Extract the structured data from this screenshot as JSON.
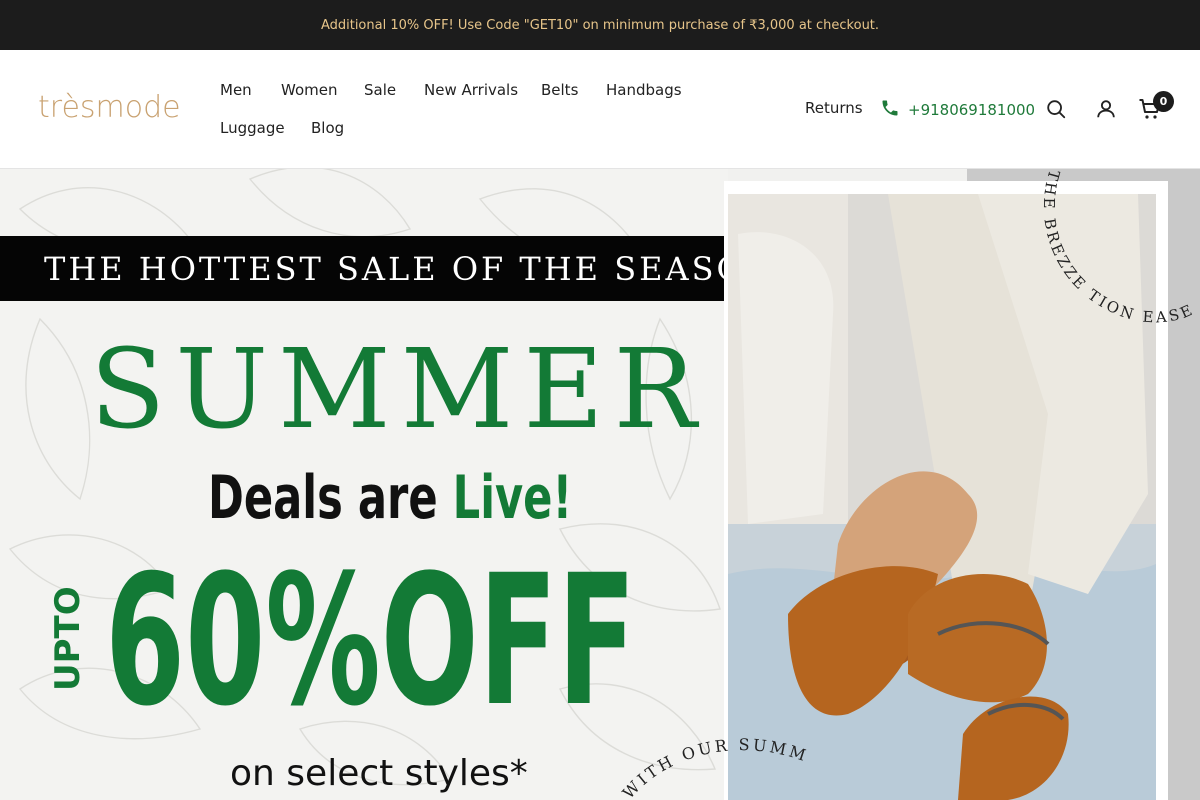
{
  "announcement": {
    "text": "Additional 10% OFF! Use Code \"GET10\" on minimum purchase of ₹3,000 at checkout."
  },
  "brand": {
    "logo_text": "trèsmode"
  },
  "nav": {
    "items": [
      {
        "label": "Men"
      },
      {
        "label": "Women"
      },
      {
        "label": "Sale"
      },
      {
        "label": "New Arrivals"
      },
      {
        "label": "Belts"
      },
      {
        "label": "Handbags"
      },
      {
        "label": "Luggage"
      },
      {
        "label": "Blog"
      }
    ]
  },
  "header": {
    "returns_label": "Returns",
    "phone": "+918069181000",
    "cart_count": "0",
    "icons": [
      "phone-icon",
      "search-icon",
      "account-icon",
      "cart-icon"
    ],
    "accent_color": "#1f7a3a"
  },
  "hero": {
    "banner": "THE HOTTEST SALE OF THE SEASON!",
    "headline": "SUMMER",
    "deals_prefix": "Deals are",
    "deals_highlight": "Live!",
    "upto": "UPTO",
    "discount": "60%OFF",
    "subtext": "on select styles*",
    "circular_text_top": "THE BREZZE ... TION EASE THE BREZZE",
    "circular_text_bottom": "WITH OUR SUMM",
    "colors": {
      "green": "#137a36",
      "banner_bg": "#050505"
    }
  }
}
